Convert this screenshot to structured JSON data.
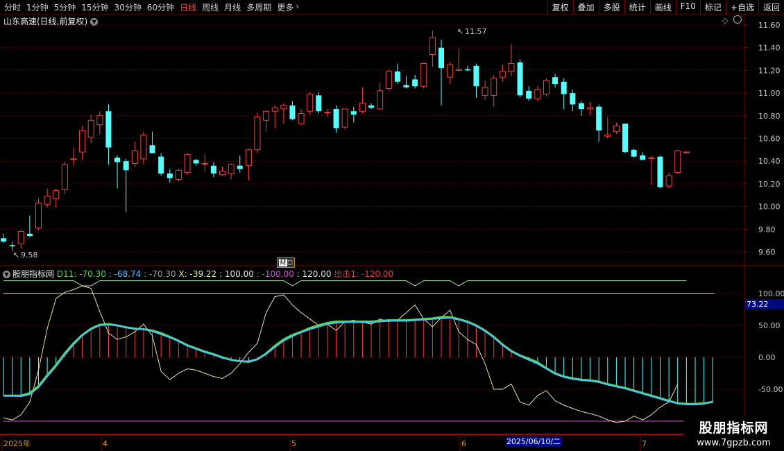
{
  "toolbar": {
    "periods": [
      "分时",
      "1分钟",
      "5分钟",
      "15分钟",
      "30分钟",
      "60分钟",
      "日线",
      "周线",
      "月线",
      "多周期",
      "更多"
    ],
    "active_period": "日线",
    "tools": [
      "复权",
      "叠加",
      "多股",
      "统计",
      "画线",
      "F10",
      "标记",
      "+自选",
      "返回"
    ]
  },
  "chart_title": "山东高速(日线,前复权)",
  "price_axis": [
    "11.60",
    "11.40",
    "11.20",
    "11.00",
    "10.80",
    "10.60",
    "10.40",
    "10.20",
    "10.00",
    "9.80",
    "9.60"
  ],
  "high_label": "11.57",
  "low_label": "9.58",
  "finance_marker": "财",
  "indicator": {
    "name": "股朋指标网",
    "items": [
      {
        "text": "D11: -70.30",
        "color": "#4cd84c"
      },
      {
        "text": ": -68.74",
        "color": "#4fc3ff"
      },
      {
        "text": ": -70.30",
        "color": "#a0a0a0"
      },
      {
        "text": "X: -39.22",
        "color": "#e6e68c"
      },
      {
        "text": ": 100.00",
        "color": "#e6e6e6"
      },
      {
        "text": ": -100.00",
        "color": "#d050d0"
      },
      {
        "text": ": 120.00",
        "color": "#e6e6e6"
      },
      {
        "text": "出击1: -120.00",
        "color": "#ff3030"
      }
    ],
    "axis": [
      "100.00",
      "50.00",
      "0.00",
      "-50.00"
    ],
    "current_value": "73.22"
  },
  "time_axis": {
    "labels": [
      "2025年",
      "4",
      "5",
      "6",
      "7"
    ],
    "cursor_date": "2025/06/10/二"
  },
  "watermark": {
    "line1": "股朋指标网",
    "line2": "www.7gpzb.com"
  },
  "colors": {
    "up": "#ff3c3c",
    "down": "#54ffff",
    "grid": "#6a0000",
    "k_line": "#4cd84c",
    "d_line": "#4fc3ff",
    "x_line": "#e6e68c",
    "bound100": "#e6e6c8",
    "bound120": "#e6e6c8",
    "bound_neg100": "#d050d0"
  },
  "chart_data": {
    "type": "candlestick",
    "y_range": [
      9.5,
      11.7
    ],
    "candles": [
      {
        "o": 9.72,
        "h": 9.76,
        "l": 9.68,
        "c": 9.69
      },
      {
        "o": 9.66,
        "h": 9.69,
        "l": 9.61,
        "c": 9.65
      },
      {
        "o": 9.67,
        "h": 9.79,
        "l": 9.63,
        "c": 9.78
      },
      {
        "o": 9.76,
        "h": 9.92,
        "l": 9.73,
        "c": 9.74
      },
      {
        "o": 9.81,
        "h": 10.07,
        "l": 9.79,
        "c": 10.03
      },
      {
        "o": 10.02,
        "h": 10.16,
        "l": 9.99,
        "c": 10.09
      },
      {
        "o": 10.07,
        "h": 10.16,
        "l": 9.99,
        "c": 10.14
      },
      {
        "o": 10.15,
        "h": 10.39,
        "l": 10.11,
        "c": 10.37
      },
      {
        "o": 10.42,
        "h": 10.52,
        "l": 10.36,
        "c": 10.42
      },
      {
        "o": 10.48,
        "h": 10.71,
        "l": 10.41,
        "c": 10.67
      },
      {
        "o": 10.61,
        "h": 10.81,
        "l": 10.56,
        "c": 10.76
      },
      {
        "o": 10.72,
        "h": 10.84,
        "l": 10.64,
        "c": 10.8
      },
      {
        "o": 10.84,
        "h": 10.9,
        "l": 10.37,
        "c": 10.52
      },
      {
        "o": 10.43,
        "h": 10.45,
        "l": 10.16,
        "c": 10.39
      },
      {
        "o": 10.4,
        "h": 10.42,
        "l": 9.95,
        "c": 10.32
      },
      {
        "o": 10.38,
        "h": 10.57,
        "l": 10.35,
        "c": 10.49
      },
      {
        "o": 10.42,
        "h": 10.66,
        "l": 10.37,
        "c": 10.63
      },
      {
        "o": 10.54,
        "h": 10.66,
        "l": 10.49,
        "c": 10.47
      },
      {
        "o": 10.44,
        "h": 10.47,
        "l": 10.27,
        "c": 10.29
      },
      {
        "o": 10.29,
        "h": 10.33,
        "l": 10.21,
        "c": 10.25
      },
      {
        "o": 10.24,
        "h": 10.33,
        "l": 10.22,
        "c": 10.32
      },
      {
        "o": 10.3,
        "h": 10.47,
        "l": 10.28,
        "c": 10.46
      },
      {
        "o": 10.41,
        "h": 10.42,
        "l": 10.36,
        "c": 10.38
      },
      {
        "o": 10.38,
        "h": 10.47,
        "l": 10.31,
        "c": 10.38
      },
      {
        "o": 10.36,
        "h": 10.39,
        "l": 10.26,
        "c": 10.29
      },
      {
        "o": 10.28,
        "h": 10.35,
        "l": 10.27,
        "c": 10.31
      },
      {
        "o": 10.29,
        "h": 10.38,
        "l": 10.24,
        "c": 10.37
      },
      {
        "o": 10.36,
        "h": 10.45,
        "l": 10.3,
        "c": 10.33
      },
      {
        "o": 10.36,
        "h": 10.51,
        "l": 10.23,
        "c": 10.5
      },
      {
        "o": 10.5,
        "h": 10.83,
        "l": 10.47,
        "c": 10.79
      },
      {
        "o": 10.76,
        "h": 10.85,
        "l": 10.66,
        "c": 10.84
      },
      {
        "o": 10.84,
        "h": 10.89,
        "l": 10.69,
        "c": 10.87
      },
      {
        "o": 10.86,
        "h": 10.91,
        "l": 10.73,
        "c": 10.89
      },
      {
        "o": 10.89,
        "h": 10.93,
        "l": 10.76,
        "c": 10.77
      },
      {
        "o": 10.73,
        "h": 10.86,
        "l": 10.72,
        "c": 10.82
      },
      {
        "o": 10.84,
        "h": 11.01,
        "l": 10.81,
        "c": 10.99
      },
      {
        "o": 10.98,
        "h": 11.01,
        "l": 10.82,
        "c": 10.84
      },
      {
        "o": 10.83,
        "h": 10.86,
        "l": 10.79,
        "c": 10.83
      },
      {
        "o": 10.86,
        "h": 10.89,
        "l": 10.65,
        "c": 10.69
      },
      {
        "o": 10.7,
        "h": 10.85,
        "l": 10.68,
        "c": 10.86
      },
      {
        "o": 10.84,
        "h": 10.88,
        "l": 10.74,
        "c": 10.81
      },
      {
        "o": 10.84,
        "h": 11.05,
        "l": 10.82,
        "c": 10.91
      },
      {
        "o": 10.89,
        "h": 10.91,
        "l": 10.86,
        "c": 10.87
      },
      {
        "o": 10.86,
        "h": 11.09,
        "l": 10.85,
        "c": 11.02
      },
      {
        "o": 11.04,
        "h": 11.21,
        "l": 11.02,
        "c": 11.19
      },
      {
        "o": 11.19,
        "h": 11.26,
        "l": 11.08,
        "c": 11.1
      },
      {
        "o": 11.07,
        "h": 11.15,
        "l": 11.04,
        "c": 11.05
      },
      {
        "o": 11.12,
        "h": 11.16,
        "l": 11.04,
        "c": 11.06
      },
      {
        "o": 11.06,
        "h": 11.27,
        "l": 11.04,
        "c": 11.26
      },
      {
        "o": 11.34,
        "h": 11.55,
        "l": 11.23,
        "c": 11.49
      },
      {
        "o": 11.4,
        "h": 11.47,
        "l": 10.89,
        "c": 11.22
      },
      {
        "o": 11.14,
        "h": 11.27,
        "l": 11.08,
        "c": 11.25
      },
      {
        "o": 11.2,
        "h": 11.39,
        "l": 11.19,
        "c": 11.21
      },
      {
        "o": 11.21,
        "h": 11.24,
        "l": 11.19,
        "c": 11.2
      },
      {
        "o": 11.24,
        "h": 11.26,
        "l": 10.96,
        "c": 11.06
      },
      {
        "o": 10.98,
        "h": 11.11,
        "l": 10.94,
        "c": 11.05
      },
      {
        "o": 10.98,
        "h": 11.16,
        "l": 10.88,
        "c": 11.13
      },
      {
        "o": 11.14,
        "h": 11.25,
        "l": 11.1,
        "c": 11.19
      },
      {
        "o": 11.19,
        "h": 11.43,
        "l": 11.15,
        "c": 11.26
      },
      {
        "o": 11.27,
        "h": 11.3,
        "l": 10.96,
        "c": 10.98
      },
      {
        "o": 11.02,
        "h": 11.06,
        "l": 10.93,
        "c": 10.95
      },
      {
        "o": 10.95,
        "h": 11.06,
        "l": 10.93,
        "c": 11.03
      },
      {
        "o": 10.99,
        "h": 11.13,
        "l": 10.97,
        "c": 11.11
      },
      {
        "o": 11.14,
        "h": 11.17,
        "l": 11.05,
        "c": 11.08
      },
      {
        "o": 11.1,
        "h": 11.13,
        "l": 10.86,
        "c": 10.99
      },
      {
        "o": 11.0,
        "h": 11.03,
        "l": 10.84,
        "c": 10.9
      },
      {
        "o": 10.91,
        "h": 10.93,
        "l": 10.8,
        "c": 10.86
      },
      {
        "o": 10.86,
        "h": 10.92,
        "l": 10.81,
        "c": 10.87
      },
      {
        "o": 10.88,
        "h": 10.9,
        "l": 10.57,
        "c": 10.67
      },
      {
        "o": 10.62,
        "h": 10.79,
        "l": 10.6,
        "c": 10.63
      },
      {
        "o": 10.66,
        "h": 10.74,
        "l": 10.64,
        "c": 10.71
      },
      {
        "o": 10.73,
        "h": 10.73,
        "l": 10.47,
        "c": 10.48
      },
      {
        "o": 10.5,
        "h": 10.51,
        "l": 10.43,
        "c": 10.44
      },
      {
        "o": 10.45,
        "h": 10.48,
        "l": 10.41,
        "c": 10.41
      },
      {
        "o": 10.43,
        "h": 10.45,
        "l": 10.19,
        "c": 10.43
      },
      {
        "o": 10.44,
        "h": 10.45,
        "l": 10.16,
        "c": 10.17
      },
      {
        "o": 10.18,
        "h": 10.3,
        "l": 10.16,
        "c": 10.27
      },
      {
        "o": 10.3,
        "h": 10.5,
        "l": 10.29,
        "c": 10.49
      },
      {
        "o": 10.48,
        "h": 10.48,
        "l": 10.48,
        "c": 10.48
      }
    ],
    "indicator_range": [
      -120,
      120
    ],
    "k_line": [
      -60,
      -60,
      -60,
      -56,
      -45,
      -28,
      -12,
      6,
      22,
      35,
      45,
      51,
      52,
      50,
      47,
      45,
      44,
      42,
      38,
      32,
      26,
      19,
      14,
      9,
      5,
      0,
      -4,
      -6,
      -7,
      -3,
      6,
      18,
      28,
      35,
      40,
      46,
      50,
      54,
      56,
      56,
      56,
      56,
      56,
      57,
      58,
      58,
      58,
      59,
      60,
      61,
      63,
      63,
      60,
      56,
      50,
      42,
      32,
      20,
      10,
      3,
      -2,
      -8,
      -17,
      -25,
      -30,
      -33,
      -35,
      -36,
      -38,
      -42,
      -45,
      -48,
      -52,
      -56,
      -60,
      -64,
      -68,
      -72,
      -73,
      -73,
      -72,
      -70
    ],
    "d_line": [
      -60,
      -60,
      -61,
      -58,
      -47,
      -30,
      -14,
      4,
      20,
      34,
      44,
      50,
      51,
      50,
      47,
      45,
      44,
      41,
      36,
      31,
      25,
      18,
      13,
      8,
      4,
      -1,
      -4,
      -6,
      -6,
      -3,
      5,
      16,
      26,
      33,
      39,
      44,
      48,
      52,
      54,
      55,
      55,
      55,
      55,
      56,
      57,
      57,
      57,
      58,
      59,
      60,
      61,
      62,
      59,
      55,
      49,
      41,
      31,
      19,
      9,
      2,
      -4,
      -10,
      -18,
      -26,
      -31,
      -34,
      -36,
      -37,
      -39,
      -43,
      -46,
      -49,
      -53,
      -57,
      -61,
      -65,
      -69,
      -72,
      -74,
      -74,
      -73,
      -69
    ],
    "x_line": [
      -95,
      -98,
      -90,
      -70,
      -20,
      45,
      92,
      102,
      106,
      112,
      108,
      72,
      38,
      28,
      32,
      40,
      52,
      34,
      -22,
      -35,
      -25,
      -18,
      -20,
      -25,
      -30,
      -33,
      -25,
      -10,
      8,
      22,
      70,
      95,
      98,
      82,
      70,
      60,
      50,
      52,
      42,
      56,
      58,
      55,
      52,
      60,
      56,
      58,
      70,
      82,
      60,
      48,
      62,
      74,
      40,
      28,
      20,
      -10,
      -50,
      -50,
      -42,
      -70,
      -75,
      -60,
      -52,
      -68,
      -75,
      -80,
      -85,
      -88,
      -92,
      -98,
      -102,
      -100,
      -92,
      -98,
      -90,
      -78,
      -70,
      -42
    ]
  }
}
